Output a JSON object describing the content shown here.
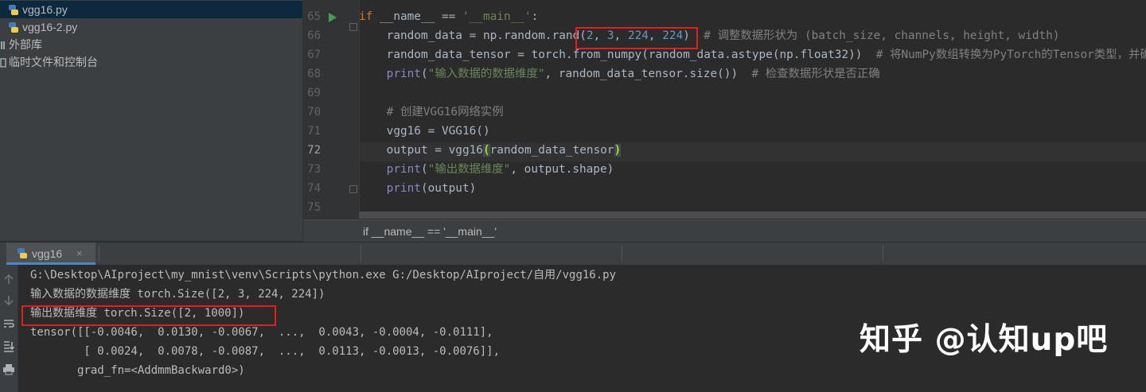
{
  "project_tree": {
    "items": [
      {
        "label": "vgg16.py",
        "icon": "python-file-icon",
        "selected": true
      },
      {
        "label": "vgg16-2.py",
        "icon": "python-file-icon",
        "selected": false
      },
      {
        "label": "外部库",
        "icon": "library-icon",
        "selected": false
      },
      {
        "label": "临时文件和控制台",
        "icon": "scratches-icon",
        "selected": false
      }
    ]
  },
  "editor": {
    "line_numbers": [
      "65",
      "66",
      "67",
      "68",
      "69",
      "70",
      "71",
      "72",
      "73",
      "74",
      "75"
    ],
    "lines": [
      {
        "segments": [
          {
            "t": "if",
            "c": "kw"
          },
          {
            "t": " __name__ == ",
            "c": ""
          },
          {
            "t": "'__main__'",
            "c": "str"
          },
          {
            "t": ":",
            "c": ""
          }
        ]
      },
      {
        "segments": [
          {
            "t": "    random_data = np.random.rand(",
            "c": ""
          },
          {
            "t": "2",
            "c": "num"
          },
          {
            "t": ", ",
            "c": ""
          },
          {
            "t": "3",
            "c": "num"
          },
          {
            "t": ", ",
            "c": ""
          },
          {
            "t": "224",
            "c": "num"
          },
          {
            "t": ", ",
            "c": ""
          },
          {
            "t": "224",
            "c": "num"
          },
          {
            "t": ")  ",
            "c": ""
          },
          {
            "t": "# 调整数据形状为 (batch_size, channels, height, width)",
            "c": "cmt"
          }
        ]
      },
      {
        "segments": [
          {
            "t": "    random_data_tensor = torch.from_numpy(random_data.astype(np.float32))  ",
            "c": ""
          },
          {
            "t": "# 将NumPy数组转换为PyTorch的Tensor类型，并确",
            "c": "cmt"
          }
        ]
      },
      {
        "segments": [
          {
            "t": "    ",
            "c": ""
          },
          {
            "t": "print",
            "c": "fn"
          },
          {
            "t": "(",
            "c": ""
          },
          {
            "t": "\"输入数据的数据维度\"",
            "c": "str"
          },
          {
            "t": ", random_data_tensor.size())  ",
            "c": ""
          },
          {
            "t": "# 检查数据形状是否正确",
            "c": "cmt"
          }
        ]
      },
      {
        "segments": []
      },
      {
        "segments": [
          {
            "t": "    ",
            "c": ""
          },
          {
            "t": "# 创建VGG16网络实例",
            "c": "cmt"
          }
        ]
      },
      {
        "segments": [
          {
            "t": "    vgg16 = VGG16()",
            "c": ""
          }
        ]
      },
      {
        "segments": [
          {
            "t": "    output = vgg16",
            "c": ""
          },
          {
            "t": "(",
            "c": "paren-hl"
          },
          {
            "t": "random_data_tensor",
            "c": ""
          },
          {
            "t": ")",
            "c": "paren-hl"
          }
        ]
      },
      {
        "segments": [
          {
            "t": "    ",
            "c": ""
          },
          {
            "t": "print",
            "c": "fn"
          },
          {
            "t": "(",
            "c": ""
          },
          {
            "t": "\"输出数据维度\"",
            "c": "str"
          },
          {
            "t": ", output.shape)",
            "c": ""
          }
        ]
      },
      {
        "segments": [
          {
            "t": "    ",
            "c": ""
          },
          {
            "t": "print",
            "c": "fn"
          },
          {
            "t": "(output)",
            "c": ""
          }
        ]
      },
      {
        "segments": []
      }
    ],
    "breadcrumb": "if __name__ == '__main__'"
  },
  "run_panel": {
    "tab_label": "vgg16",
    "tab_close": "×",
    "console_lines": [
      "G:\\Desktop\\AIproject\\my_mnist\\venv\\Scripts\\python.exe G:/Desktop/AIproject/自用/vgg16.py",
      "输入数据的数据维度 torch.Size([2, 3, 224, 224])",
      "输出数据维度 torch.Size([2, 1000])",
      "tensor([[-0.0046,  0.0130, -0.0067,  ...,  0.0043, -0.0004, -0.0111],",
      "        [ 0.0024,  0.0078, -0.0087,  ...,  0.0113, -0.0013, -0.0076]],",
      "       grad_fn=<AddmmBackward0>)"
    ]
  },
  "watermark": "知乎 @认知up吧",
  "colors": {
    "accent_red": "#e02020",
    "keyword": "#cc7832",
    "string": "#6a8759",
    "number": "#6897bb",
    "comment": "#808080"
  }
}
